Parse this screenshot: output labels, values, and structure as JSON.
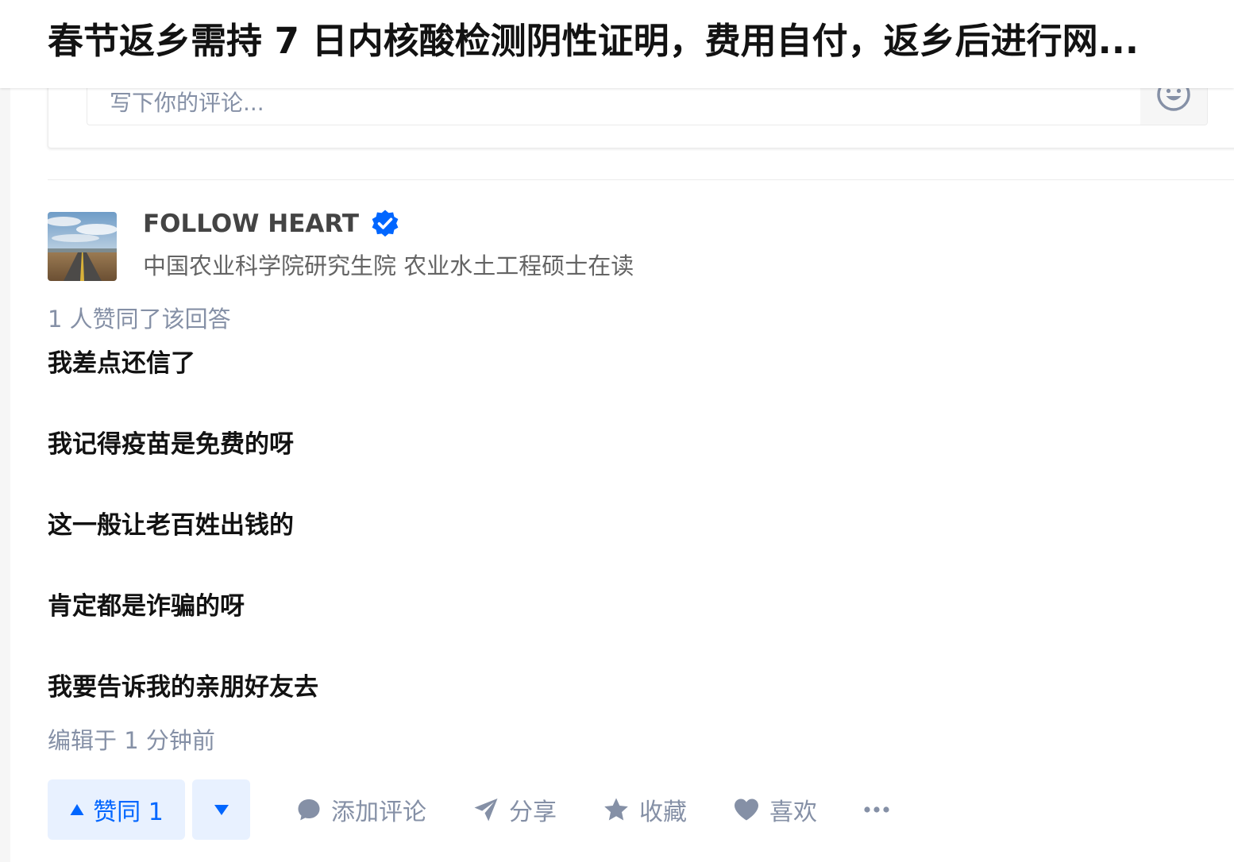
{
  "question": {
    "title": "春节返乡需持 7 日内核酸检测阴性证明，费用自付，返乡后进行网..."
  },
  "comment_box": {
    "placeholder": "写下你的评论..."
  },
  "answer": {
    "author": {
      "name": "FOLLOW HEART",
      "verified": true,
      "bio": "中国农业科学院研究生院 农业水土工程硕士在读"
    },
    "vote_summary": "1 人赞同了该回答",
    "paragraphs": [
      "我差点还信了",
      "我记得疫苗是免费的呀",
      "这一般让老百姓出钱的",
      "肯定都是诈骗的呀",
      "我要告诉我的亲朋好友去"
    ],
    "edited": "编辑于 1 分钟前"
  },
  "actions": {
    "upvote_label": "赞同 1",
    "comment_label": "添加评论",
    "share_label": "分享",
    "collect_label": "收藏",
    "like_label": "喜欢"
  },
  "colors": {
    "accent": "#0066ff",
    "verified": "#0066ff",
    "muted": "#8590a6",
    "vote_bg": "#e8f1ff"
  }
}
